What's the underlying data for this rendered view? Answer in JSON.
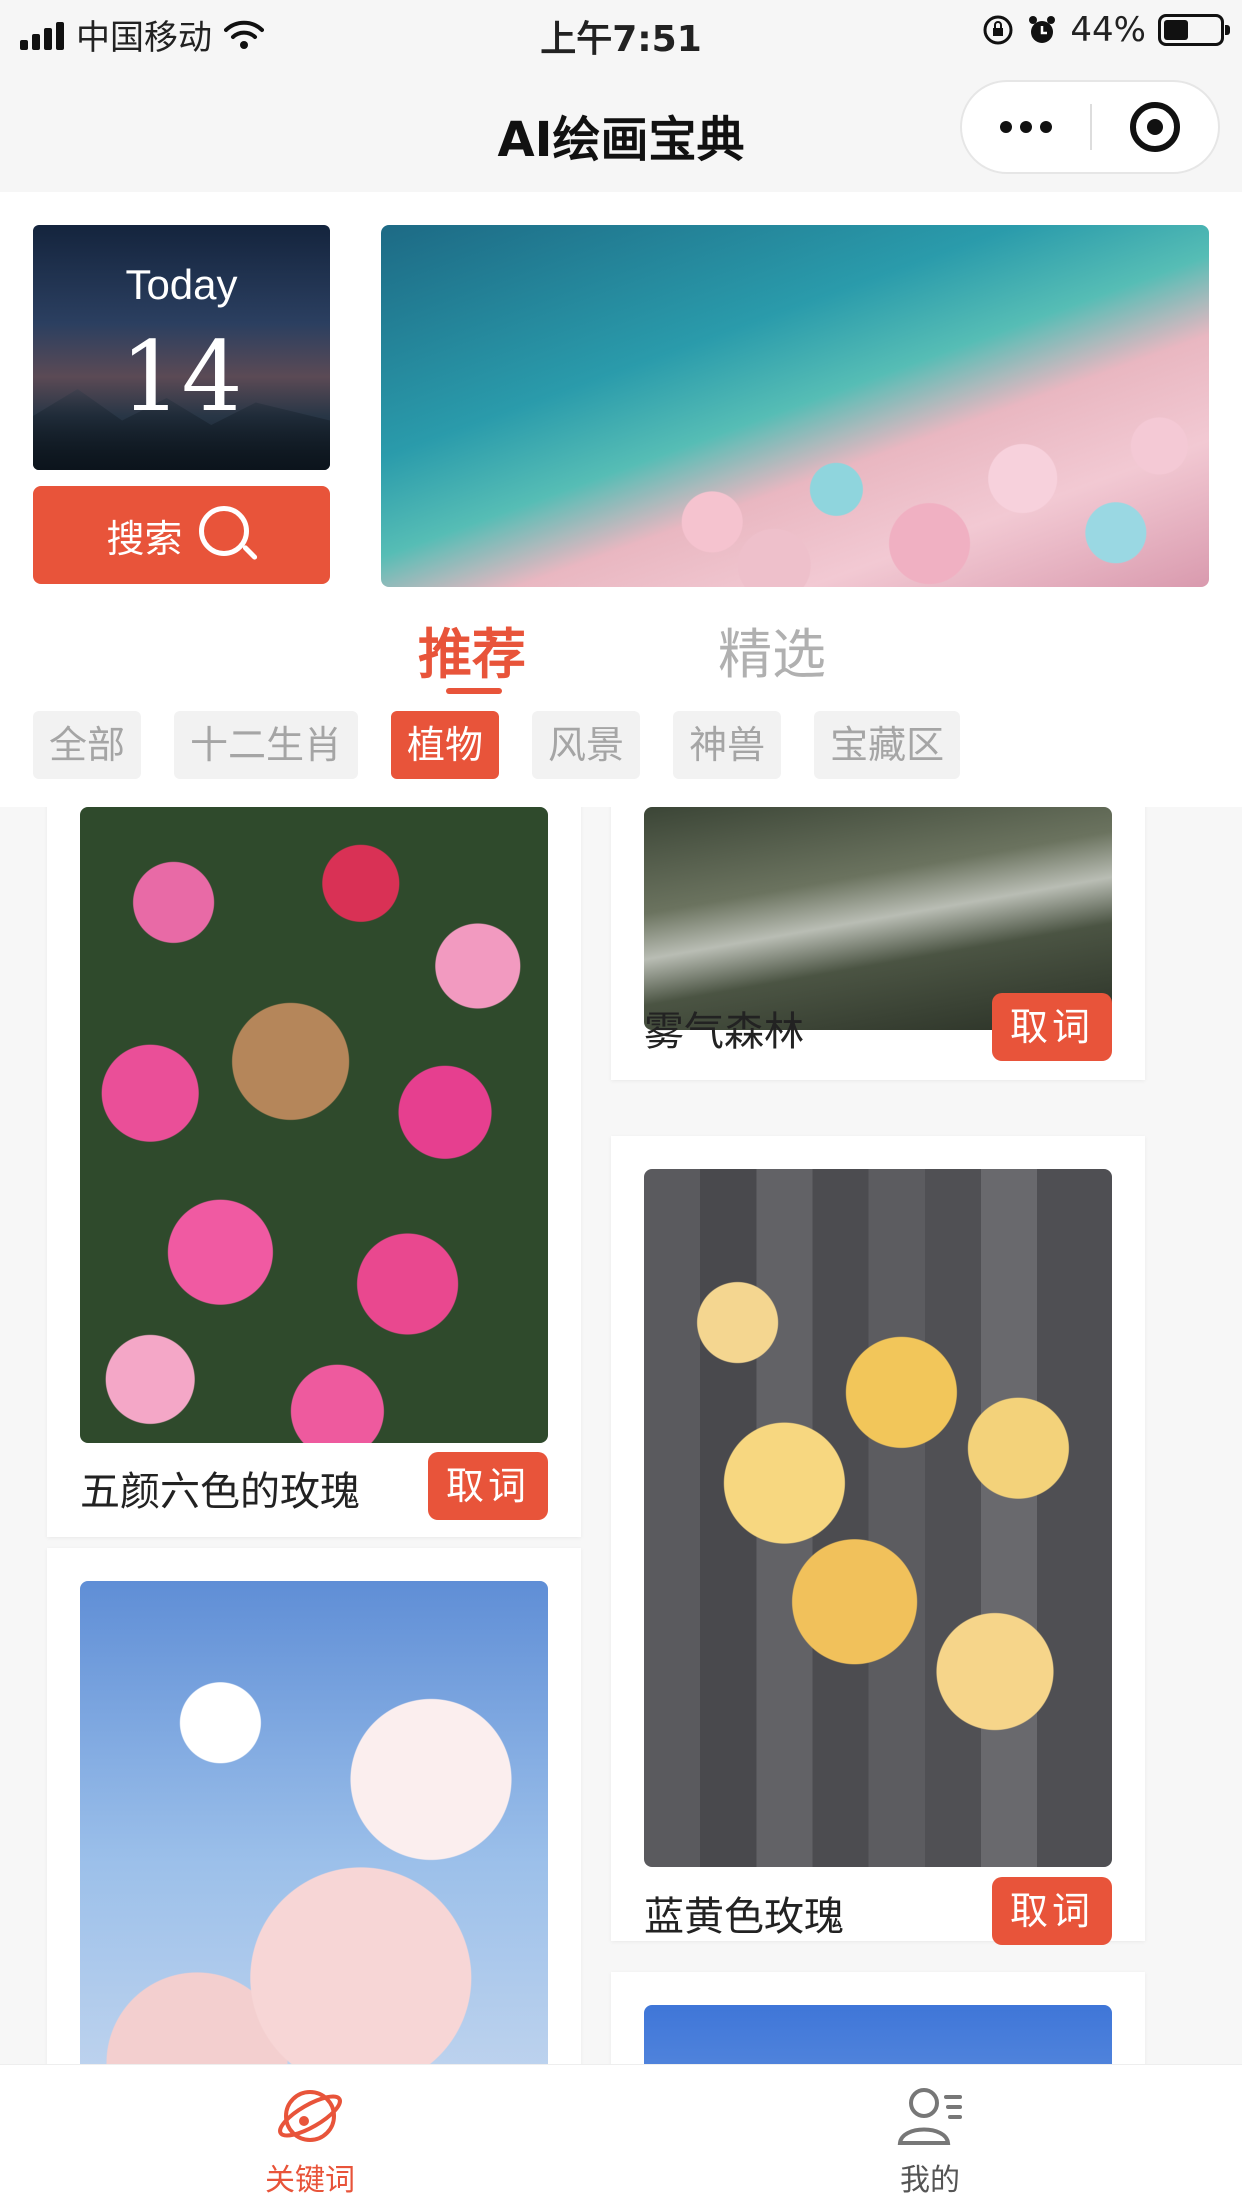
{
  "status_bar": {
    "carrier": "中国移动",
    "time": "上午7:51",
    "battery": "44%",
    "battery_level": 0.44
  },
  "nav": {
    "title": "AI绘画宝典",
    "more_icon": "more-dots-icon",
    "close_icon": "target-close-icon"
  },
  "today": {
    "label": "Today",
    "day": "14"
  },
  "search": {
    "label": "搜索"
  },
  "tabs": [
    {
      "label": "推荐",
      "active": true
    },
    {
      "label": "精选",
      "active": false
    }
  ],
  "categories": [
    {
      "label": "全部"
    },
    {
      "label": "十二生肖"
    },
    {
      "label": "植物",
      "active": true
    },
    {
      "label": "风景"
    },
    {
      "label": "神兽"
    },
    {
      "label": "宝藏区"
    }
  ],
  "feed": {
    "left": [
      {
        "title": "五颜六色的玫瑰",
        "button": "取词"
      },
      {
        "title": "",
        "button": ""
      }
    ],
    "right": [
      {
        "title": "雾气森林",
        "button": "取词"
      },
      {
        "title": "蓝黄色玫瑰",
        "button": "取词"
      },
      {
        "title": "",
        "button": ""
      }
    ]
  },
  "tabbar": {
    "items": [
      {
        "label": "关键词",
        "icon": "planet-icon",
        "active": true
      },
      {
        "label": "我的",
        "icon": "user-icon",
        "active": false
      }
    ]
  },
  "colors": {
    "accent": "#e8543a",
    "chip_bg": "#f2f2f2",
    "chip_text": "#a5a5a5"
  }
}
